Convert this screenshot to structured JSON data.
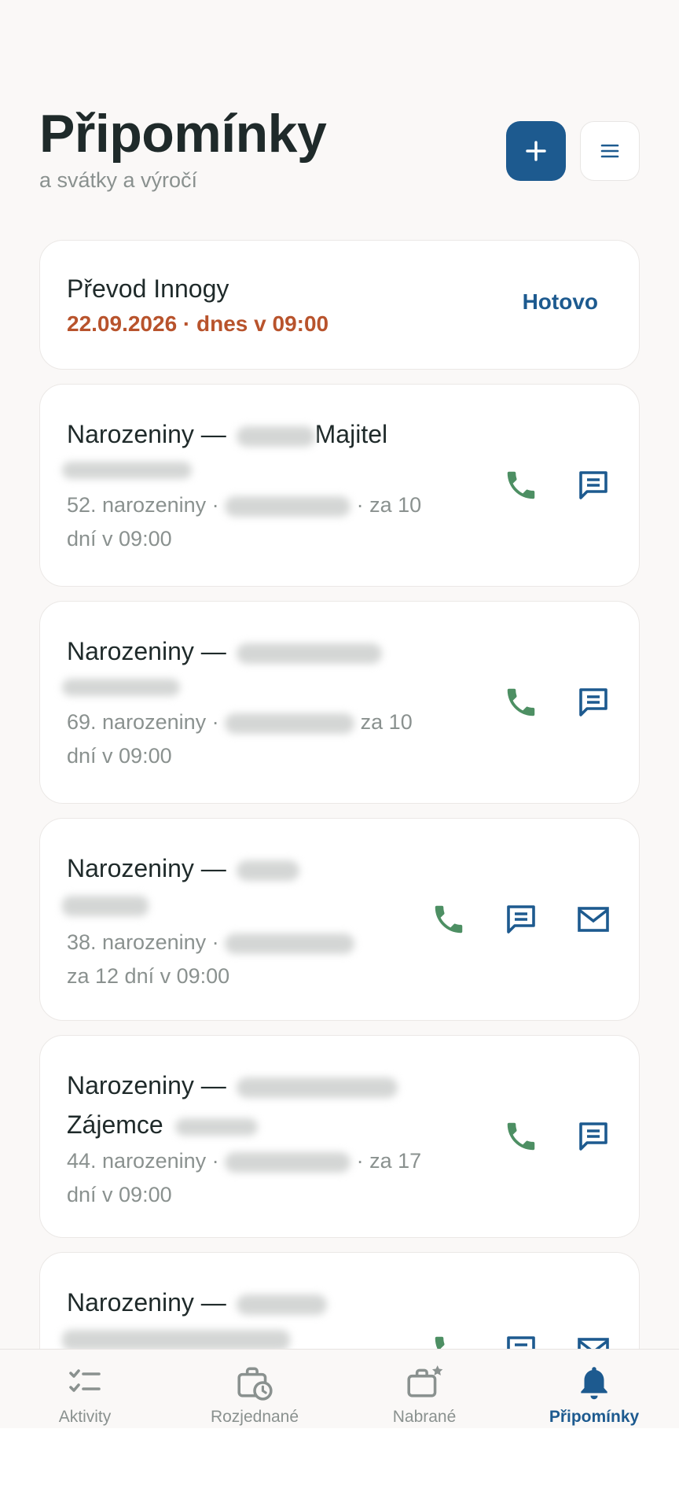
{
  "header": {
    "title": "Připomínky",
    "subtitle": "a svátky a výročí"
  },
  "reminder": {
    "title": "Převod Innogy",
    "date": "22.09.2026 · dnes v 09:00",
    "done_label": "Hotovo"
  },
  "birthdays": [
    {
      "prefix": "Narozeniny —",
      "role": "Majitel",
      "age": "52. narozeniny ·",
      "when": "· za 10",
      "when2": "dní v 09:00"
    },
    {
      "prefix": "Narozeniny —",
      "age": "69. narozeniny ·",
      "when": "za 10",
      "when2": "dní v 09:00"
    },
    {
      "prefix": "Narozeniny —",
      "age": "38. narozeniny ·",
      "when2": "za 12 dní v 09:00"
    },
    {
      "prefix": "Narozeniny —",
      "role": "Zájemce",
      "age": "44. narozeniny ·",
      "when": "· za 17",
      "when2": "dní v 09:00"
    },
    {
      "prefix": "Narozeniny —"
    }
  ],
  "nav": [
    {
      "label": "Aktivity",
      "icon": "checklist-icon"
    },
    {
      "label": "Rozjednané",
      "icon": "briefcase-clock-icon"
    },
    {
      "label": "Nabrané",
      "icon": "briefcase-star-icon"
    },
    {
      "label": "Připomínky",
      "icon": "bell-icon"
    }
  ],
  "colors": {
    "primary": "#1d5a8f",
    "phone": "#4d8f63",
    "due_today": "#b8532c"
  }
}
